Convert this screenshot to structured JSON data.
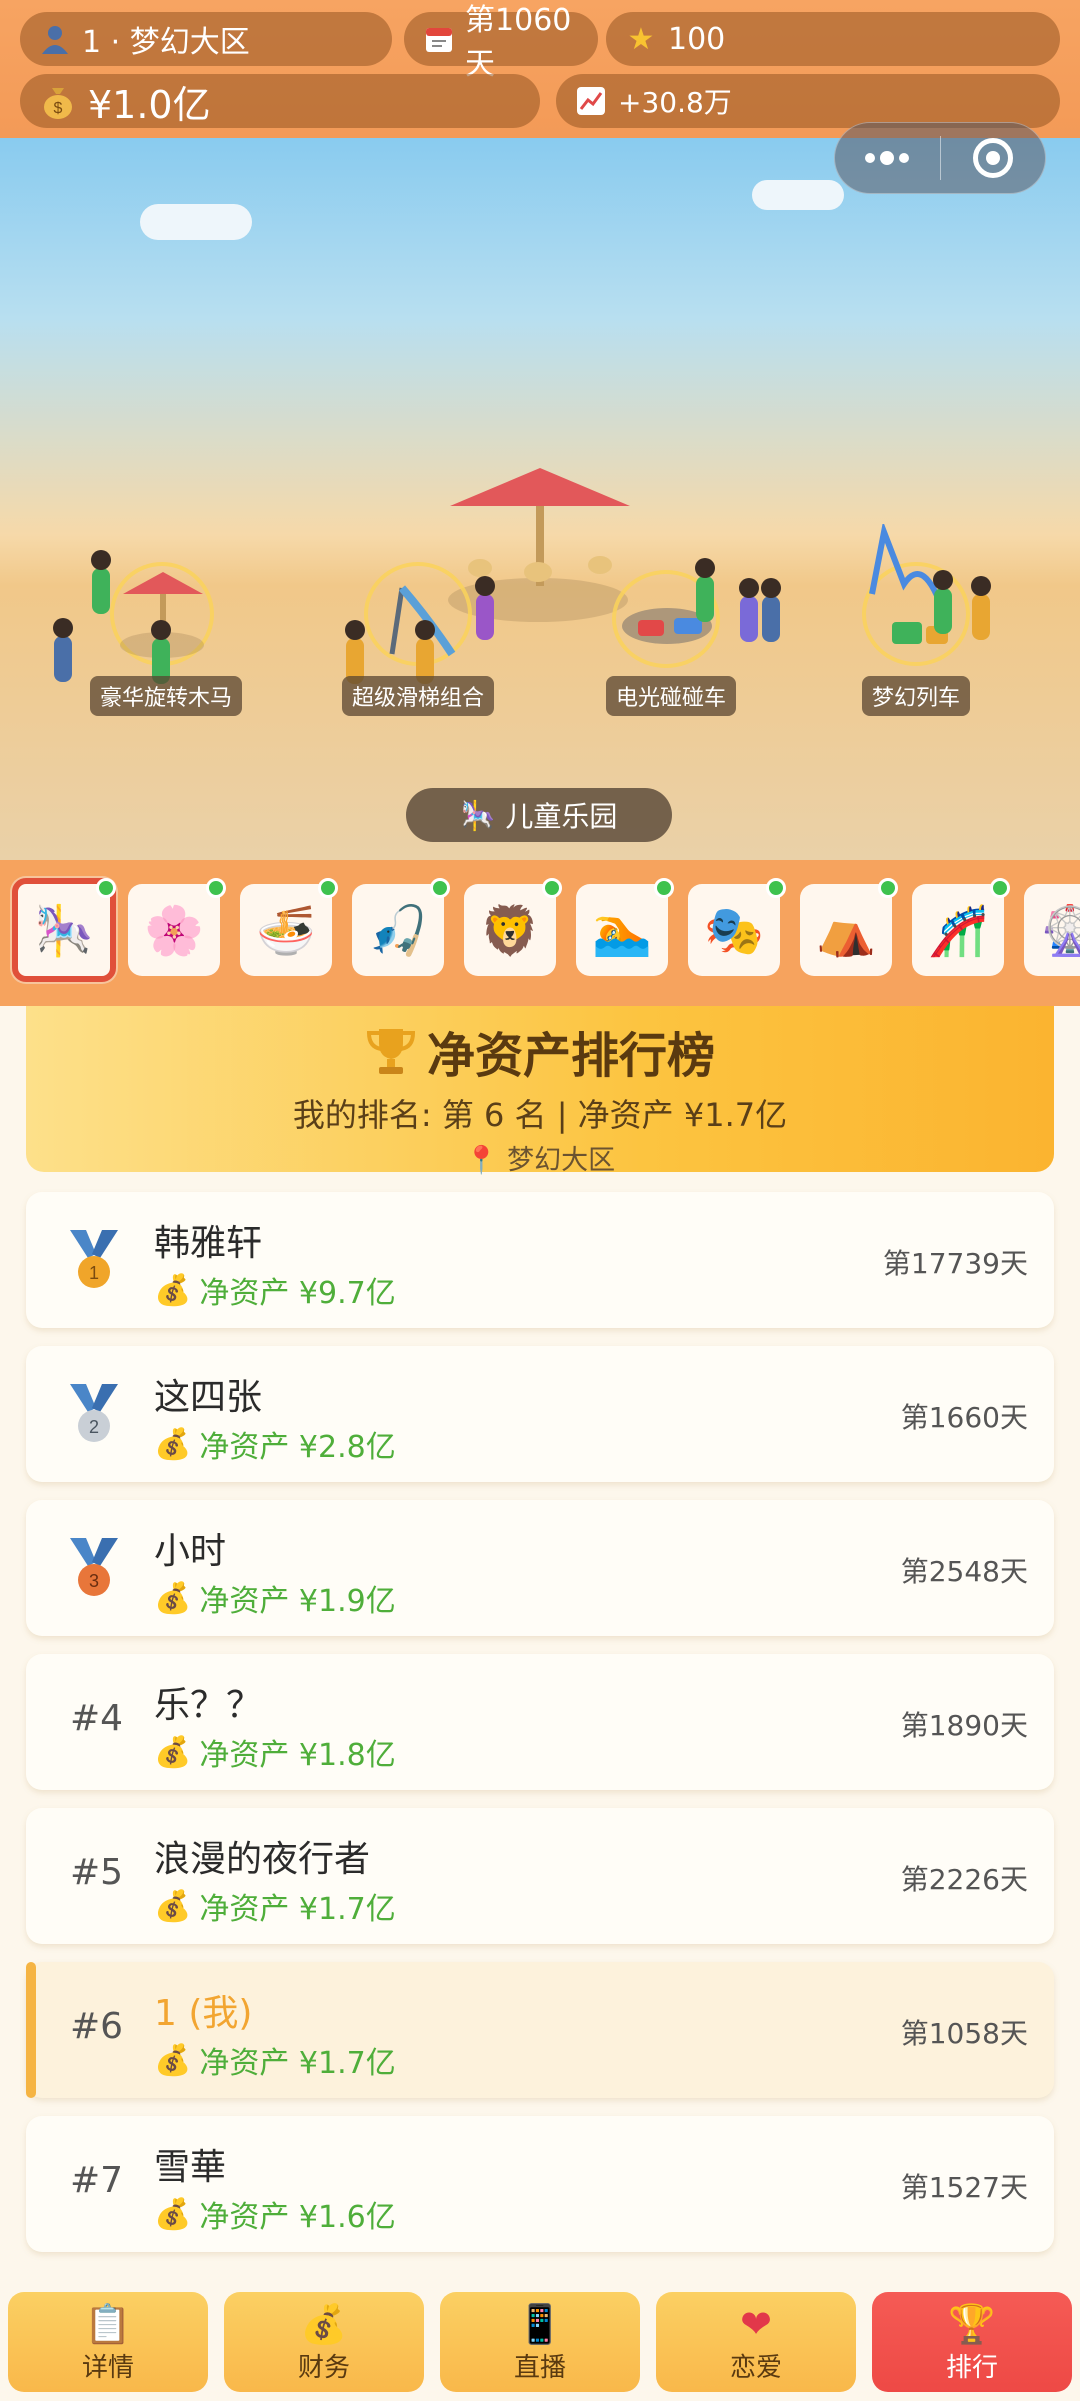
{
  "topbar": {
    "user": "1 · 梦幻大区",
    "day": "第1060天",
    "stars": "100",
    "money": "¥1.0亿",
    "growth": "+30.8万"
  },
  "scene": {
    "park_name": "儿童乐园",
    "attractions": [
      "豪华旋转木马",
      "超级滑梯组合",
      "电光碰碰车",
      "梦幻列车"
    ]
  },
  "selector": {
    "icons": [
      "carousel-icon",
      "flower-icon",
      "noodle-icon",
      "fishing-icon",
      "lion-icon",
      "swimming-icon",
      "masks-icon",
      "tent-icon",
      "roller-coaster-icon",
      "ferris-wheel-icon"
    ]
  },
  "leaderboard": {
    "title": "净资产排行榜",
    "my_rank": "我的排名: 第 6 名 | 净资产 ¥1.7亿",
    "region": "梦幻大区",
    "rows": [
      {
        "rank": "1",
        "name": "韩雅轩",
        "asset": "净资产 ¥9.7亿",
        "days": "第17739天"
      },
      {
        "rank": "2",
        "name": "这四张",
        "asset": "净资产 ¥2.8亿",
        "days": "第1660天"
      },
      {
        "rank": "3",
        "name": "小时",
        "asset": "净资产 ¥1.9亿",
        "days": "第2548天"
      },
      {
        "rank": "#4",
        "name": "乐？？",
        "asset": "净资产 ¥1.8亿",
        "days": "第1890天"
      },
      {
        "rank": "#5",
        "name": "浪漫的夜行者",
        "asset": "净资产 ¥1.7亿",
        "days": "第2226天"
      },
      {
        "rank": "#6",
        "name": "1 (我)",
        "asset": "净资产 ¥1.7亿",
        "days": "第1058天"
      },
      {
        "rank": "#7",
        "name": "雪華",
        "asset": "净资产 ¥1.6亿",
        "days": "第1527天"
      }
    ]
  },
  "nav": {
    "items": [
      {
        "label": "详情",
        "icon": "clipboard-icon"
      },
      {
        "label": "财务",
        "icon": "money-bag-icon"
      },
      {
        "label": "直播",
        "icon": "phone-icon"
      },
      {
        "label": "恋爱",
        "icon": "hearts-icon"
      },
      {
        "label": "排行",
        "icon": "trophy-icon"
      }
    ],
    "active": "排行"
  },
  "colors": {
    "topbar": "#f39a57",
    "asset_green": "#4fae3a",
    "me_accent": "#f2a531",
    "nav_active": "#ee4945",
    "nav_button": "#f9b84a"
  }
}
